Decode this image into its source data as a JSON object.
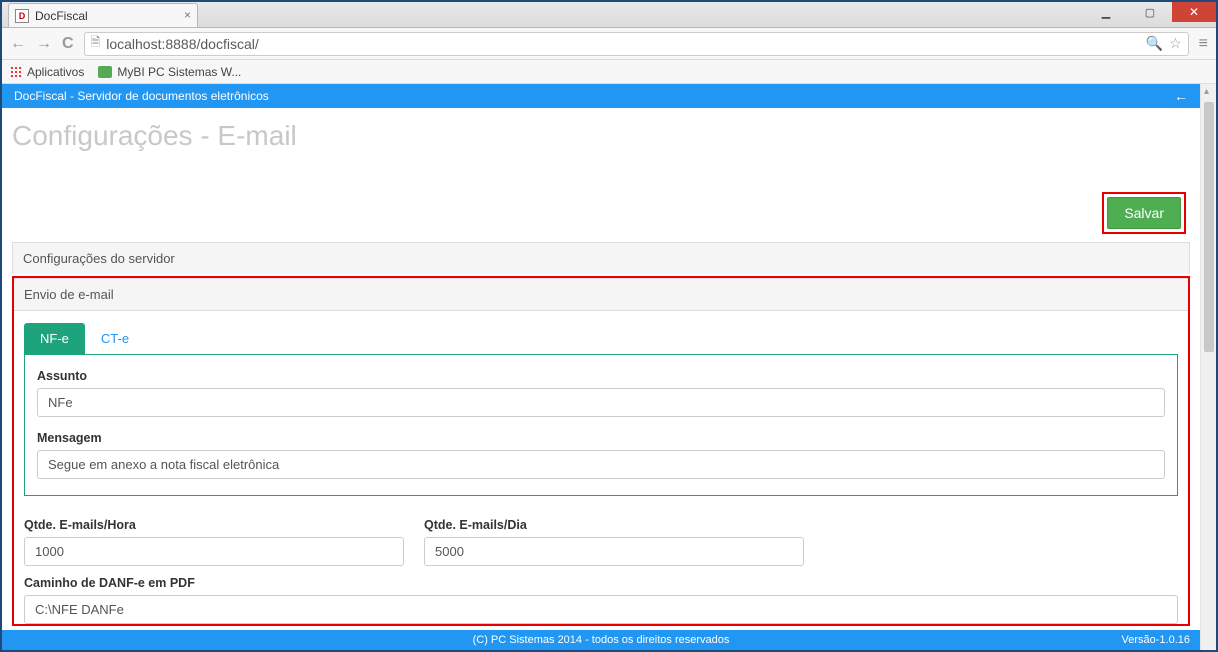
{
  "browser": {
    "tab_title": "DocFiscal",
    "url": "localhost:8888/docfiscal/",
    "bookmarks_apps": "Aplicativos",
    "bookmark1": "MyBI PC Sistemas W..."
  },
  "header": {
    "title": "DocFiscal - Servidor de documentos eletrônicos"
  },
  "page_title": "Configurações - E-mail",
  "buttons": {
    "save": "Salvar"
  },
  "panels": {
    "server_config": "Configurações do servidor",
    "email_send": "Envio de e-mail"
  },
  "tabs": {
    "nfe": "NF-e",
    "cte": "CT-e"
  },
  "fields": {
    "assunto_label": "Assunto",
    "assunto_value": "NFe",
    "mensagem_label": "Mensagem",
    "mensagem_value": "Segue em anexo a nota fiscal eletrônica",
    "qtde_hora_label": "Qtde. E-mails/Hora",
    "qtde_hora_value": "1000",
    "qtde_dia_label": "Qtde. E-mails/Dia",
    "qtde_dia_value": "5000",
    "caminho_label": "Caminho de DANF-e em PDF",
    "caminho_value": "C:\\NFE DANFe"
  },
  "footer": {
    "copyright": "(C) PC Sistemas 2014 - todos os direitos reservados",
    "version": "Versão-1.0.16"
  }
}
